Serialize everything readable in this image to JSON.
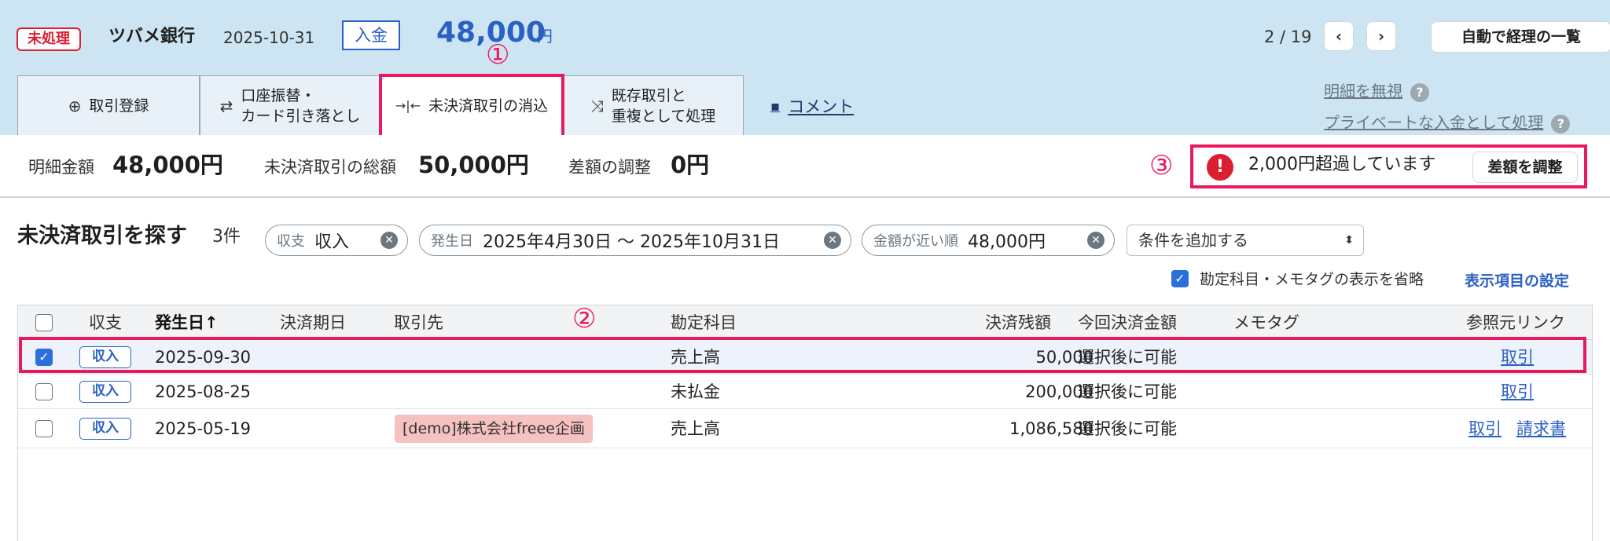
{
  "header": {
    "status": "未処理",
    "bank": "ツバメ銀行",
    "date": "2025-10-31",
    "type": "入金",
    "amount": "48,000",
    "currency": "円",
    "pager": "2 / 19",
    "prev": "‹",
    "next": "›",
    "auto_list": "自動で経理の一覧"
  },
  "annotations": {
    "a1": "①",
    "a2": "②",
    "a3": "③"
  },
  "tabs": [
    {
      "label": "取引登録",
      "icon": "⊕"
    },
    {
      "label": "口座振替・\nカード引き落とし",
      "icon": "⇄"
    },
    {
      "label": "未決済取引の消込",
      "icon": "→|←"
    },
    {
      "label": "既存取引と\n重複として処理",
      "icon": "⤨"
    }
  ],
  "comment": {
    "label": "コメント",
    "icon": "▪"
  },
  "side_links": {
    "ignore": "明細を無視",
    "private": "プライベートな入金として処理",
    "help": "?"
  },
  "summary": {
    "detail_label": "明細金額",
    "detail_value": "48,000円",
    "total_label": "未決済取引の総額",
    "total_value": "50,000円",
    "diff_label": "差額の調整",
    "diff_value": "0円",
    "warning": "2,000円超過しています",
    "warning_icon": "!",
    "adjust_button": "差額を調整"
  },
  "search": {
    "title": "未決済取引を探す",
    "count": "3件",
    "chips": [
      {
        "key": "収支",
        "value": "収入"
      },
      {
        "key": "発生日",
        "value": "2025年4月30日 〜 2025年10月31日"
      },
      {
        "key": "金額が近い順",
        "value": "48,000円"
      }
    ],
    "chip_close": "✕",
    "add_condition": "条件を追加する",
    "select_arrow": "⬍",
    "omit_label": "勘定科目・メモタグの表示を省略",
    "column_settings": "表示項目の設定"
  },
  "table": {
    "headers": {
      "type": "収支",
      "date": "発生日↑",
      "due": "決済期日",
      "partner": "取引先",
      "account": "勘定科目",
      "balance": "決済残額",
      "payment": "今回決済金額",
      "memo": "メモタグ",
      "refs": "参照元リンク"
    },
    "rows": [
      {
        "checked": true,
        "type": "収入",
        "date": "2025-09-30",
        "partner": "",
        "account": "売上高",
        "balance": "50,000",
        "payment": "選択後に可能",
        "links": [
          "取引"
        ]
      },
      {
        "checked": false,
        "type": "収入",
        "date": "2025-08-25",
        "partner": "",
        "account": "未払金",
        "balance": "200,000",
        "payment": "選択後に可能",
        "links": [
          "取引"
        ]
      },
      {
        "checked": false,
        "type": "収入",
        "date": "2025-05-19",
        "partner": "[demo]株式会社freee企画",
        "account": "売上高",
        "balance": "1,086,580",
        "payment": "選択後に可能",
        "links": [
          "取引",
          "請求書"
        ]
      }
    ]
  },
  "colors": {
    "header_bg": "#cde5f3",
    "accent": "#2b60c4",
    "danger": "#dc1e32",
    "annotation": "#e8195f"
  }
}
